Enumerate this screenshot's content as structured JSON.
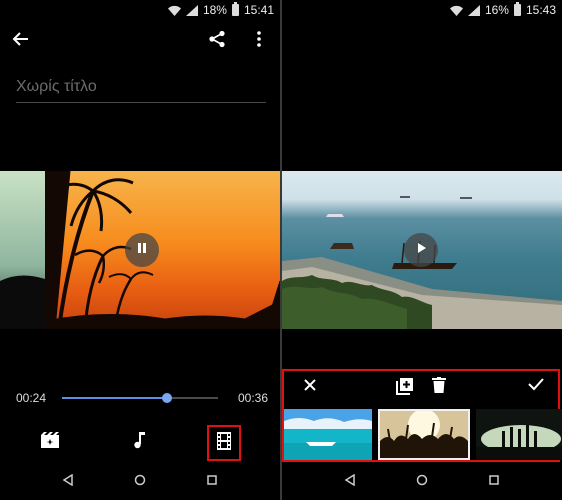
{
  "left": {
    "status": {
      "battery": "18%",
      "time": "15:41"
    },
    "title_placeholder": "Χωρίς τίτλο",
    "player": {
      "current_time": "00:24",
      "total_time": "00:36",
      "progress": 0.67
    }
  },
  "right": {
    "status": {
      "battery": "16%",
      "time": "15:43"
    }
  },
  "colors": {
    "accent": "#5c8fe6",
    "highlight": "#e01010"
  },
  "icons": {
    "back": "arrow-left-icon",
    "share": "share-icon",
    "more": "more-vert-icon",
    "pause": "pause-icon",
    "play": "play-icon",
    "theme": "movie-filter-icon",
    "music": "music-note-icon",
    "clips": "film-strip-icon",
    "close": "close-icon",
    "add": "add-clip-icon",
    "delete": "trash-icon",
    "confirm": "check-icon"
  }
}
